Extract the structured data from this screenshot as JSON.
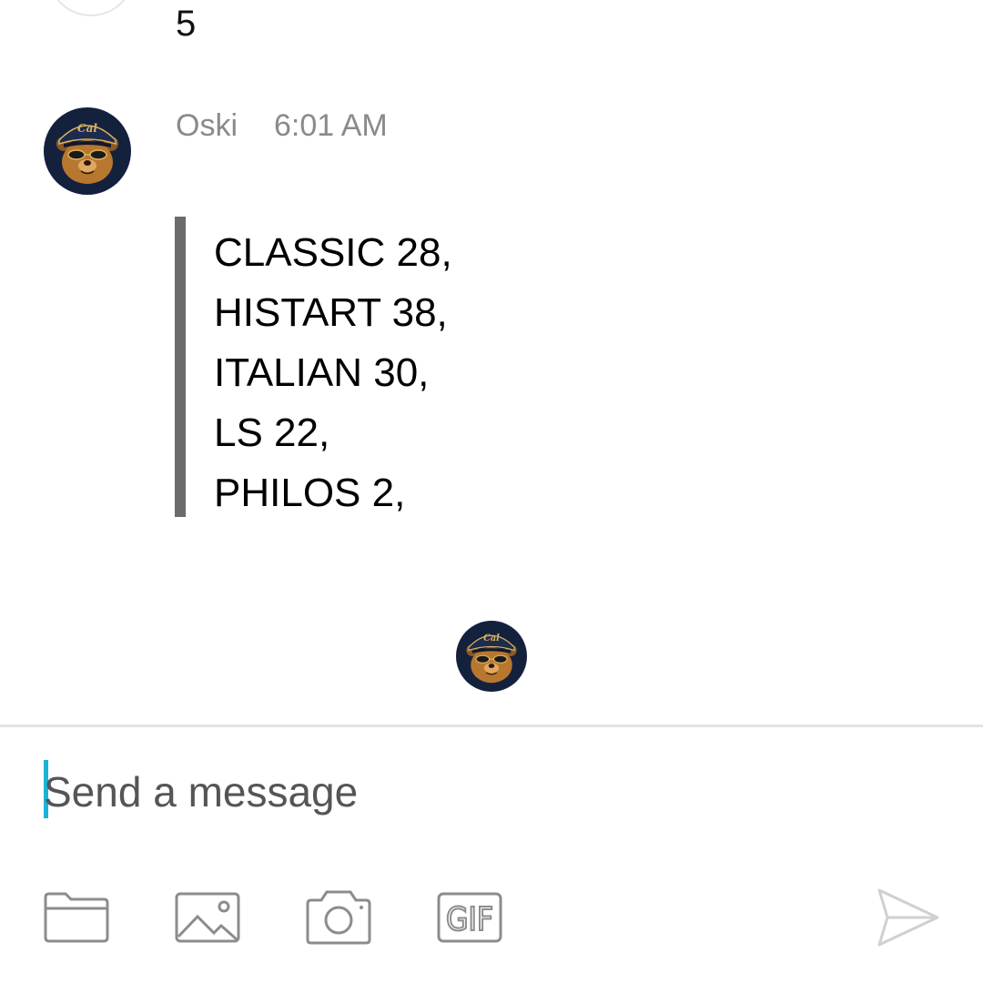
{
  "previous_message": {
    "text": "5"
  },
  "message": {
    "author": "Oski",
    "time": "6:01 AM",
    "lines": [
      "CLASSIC 28,",
      "HISTART 38,",
      "ITALIAN 30,",
      "LS 22,",
      "PHILOS 2,"
    ]
  },
  "avatar": {
    "cap_text": "Cal"
  },
  "composer": {
    "placeholder": "Send a message"
  },
  "toolbar": {
    "icons": [
      "folder-icon",
      "image-icon",
      "camera-icon",
      "gif-icon",
      "send-icon"
    ],
    "gif_label": "GIF"
  },
  "colors": {
    "caret": "#1bb3d6",
    "quote_bar": "#6b6b6b",
    "meta_text": "#8a8a8a",
    "icon_stroke": "#8c8c8c",
    "send_icon": "#d0d0d0",
    "avatar_bg": "#14213d",
    "bear": "#b8772f",
    "gold": "#d9b35c"
  }
}
